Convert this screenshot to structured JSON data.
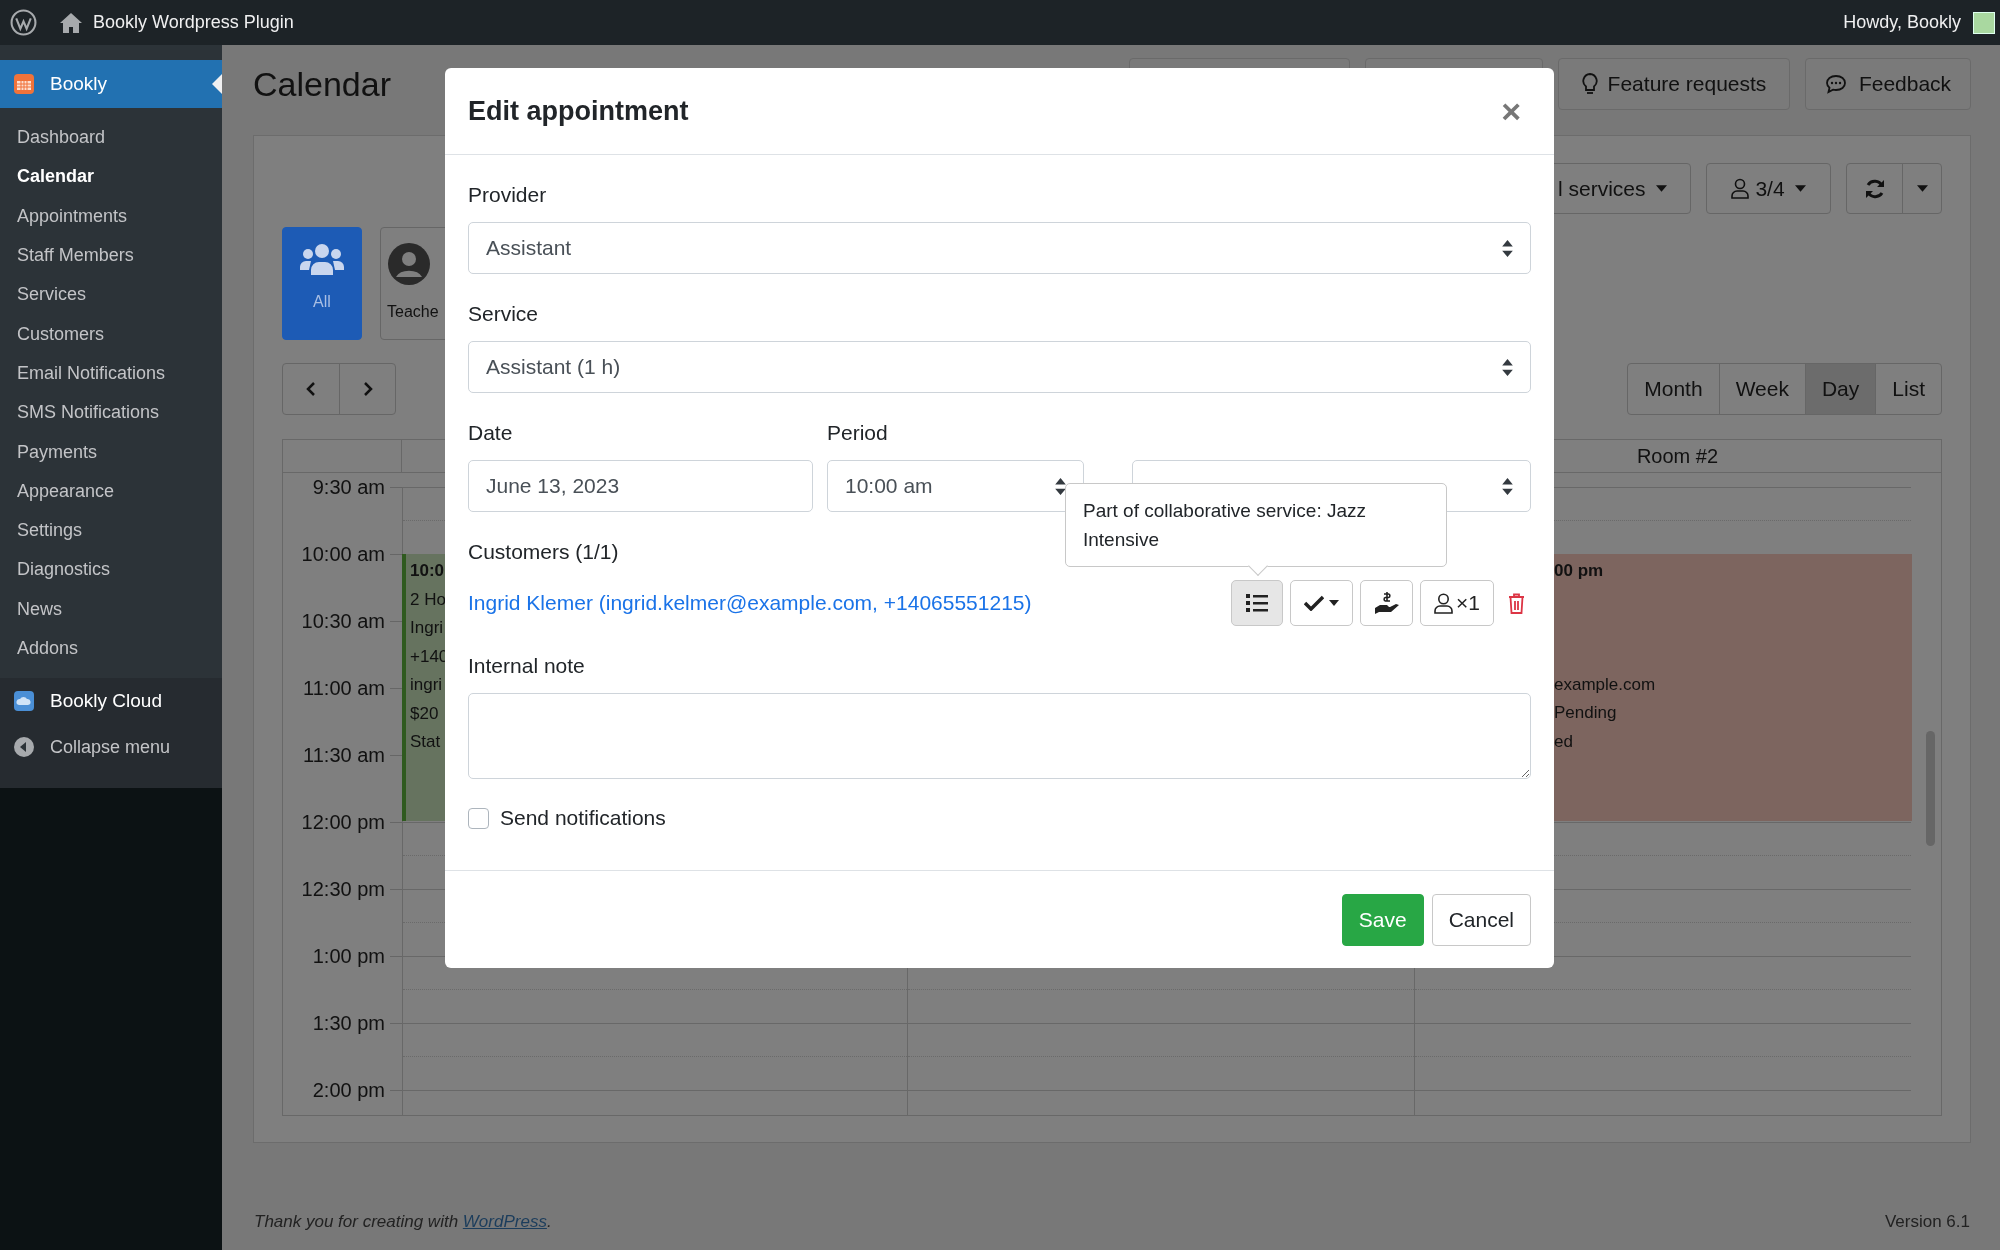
{
  "admin_bar": {
    "site_title": "Bookly Wordpress Plugin",
    "greeting": "Howdy, Bookly"
  },
  "sidebar": {
    "plugin": {
      "label": "Bookly",
      "selected": true
    },
    "items": [
      {
        "label": "Dashboard",
        "selected": false
      },
      {
        "label": "Calendar",
        "selected": true
      },
      {
        "label": "Appointments",
        "selected": false
      },
      {
        "label": "Staff Members",
        "selected": false
      },
      {
        "label": "Services",
        "selected": false
      },
      {
        "label": "Customers",
        "selected": false
      },
      {
        "label": "Email Notifications",
        "selected": false
      },
      {
        "label": "SMS Notifications",
        "selected": false
      },
      {
        "label": "Payments",
        "selected": false
      },
      {
        "label": "Appearance",
        "selected": false
      },
      {
        "label": "Settings",
        "selected": false
      },
      {
        "label": "Diagnostics",
        "selected": false
      },
      {
        "label": "News",
        "selected": false
      },
      {
        "label": "Addons",
        "selected": false
      }
    ],
    "cloud": "Bookly Cloud",
    "collapse": "Collapse menu"
  },
  "page": {
    "title": "Calendar",
    "header_buttons": [
      {
        "kind": "hidden"
      },
      {
        "kind": "hidden"
      },
      {
        "kind": "bulb",
        "label": "Feature requests"
      },
      {
        "kind": "chat",
        "label": "Feedback"
      }
    ],
    "services_filter": "l services",
    "staff_filter": "3/4",
    "staff": [
      {
        "label": "All",
        "selected": true
      },
      {
        "label": "Teache",
        "selected": false
      }
    ],
    "views": [
      {
        "label": "Month",
        "selected": false
      },
      {
        "label": "Week",
        "selected": false
      },
      {
        "label": "Day",
        "selected": true
      },
      {
        "label": "List",
        "selected": false
      }
    ],
    "calendar": {
      "column_header": "Room #2",
      "times": [
        "9:30 am",
        "10:00 am",
        "10:30 am",
        "11:00 am",
        "11:30 am",
        "12:00 pm",
        "12:30 pm",
        "1:00 pm",
        "1:30 pm",
        "2:00 pm"
      ],
      "events": [
        {
          "title": "10:0",
          "lines": [
            "2 Ho",
            "Ingri",
            "+140",
            "ingri",
            "$20",
            "Stat"
          ],
          "color": "#66735f"
        },
        {
          "title": "00 pm",
          "lines": [
            "example.com",
            "Pending",
            "ed"
          ],
          "color": "#7d655f"
        }
      ]
    }
  },
  "footer": {
    "text": "Thank you for creating with ",
    "link": "WordPress",
    "after": ".",
    "version": "Version 6.1"
  },
  "modal": {
    "title": "Edit appointment",
    "close": "×",
    "selects": [
      {
        "label": "Provider",
        "value": "Assistant"
      },
      {
        "label": "Service",
        "value": "Assistant (1 h)"
      }
    ],
    "date": {
      "label": "Date",
      "value": "June 13, 2023"
    },
    "period": {
      "label": "Period",
      "start": "10:00 am"
    },
    "customers": {
      "label": "Customers (1/1)",
      "items": [
        {
          "name": "Ingrid Klemer (ingrid.kelmer@example.com, +14065551215)",
          "details_open": true,
          "tooltip": "Part of collaborative service: Jazz Intensive",
          "quantity": "×1"
        }
      ]
    },
    "internal_note": {
      "label": "Internal note"
    },
    "send_notifications": {
      "label": "Send notifications",
      "checked": false
    },
    "buttons": [
      {
        "label": "Save",
        "kind": "primary"
      },
      {
        "label": "Cancel",
        "kind": "secondary"
      }
    ]
  }
}
